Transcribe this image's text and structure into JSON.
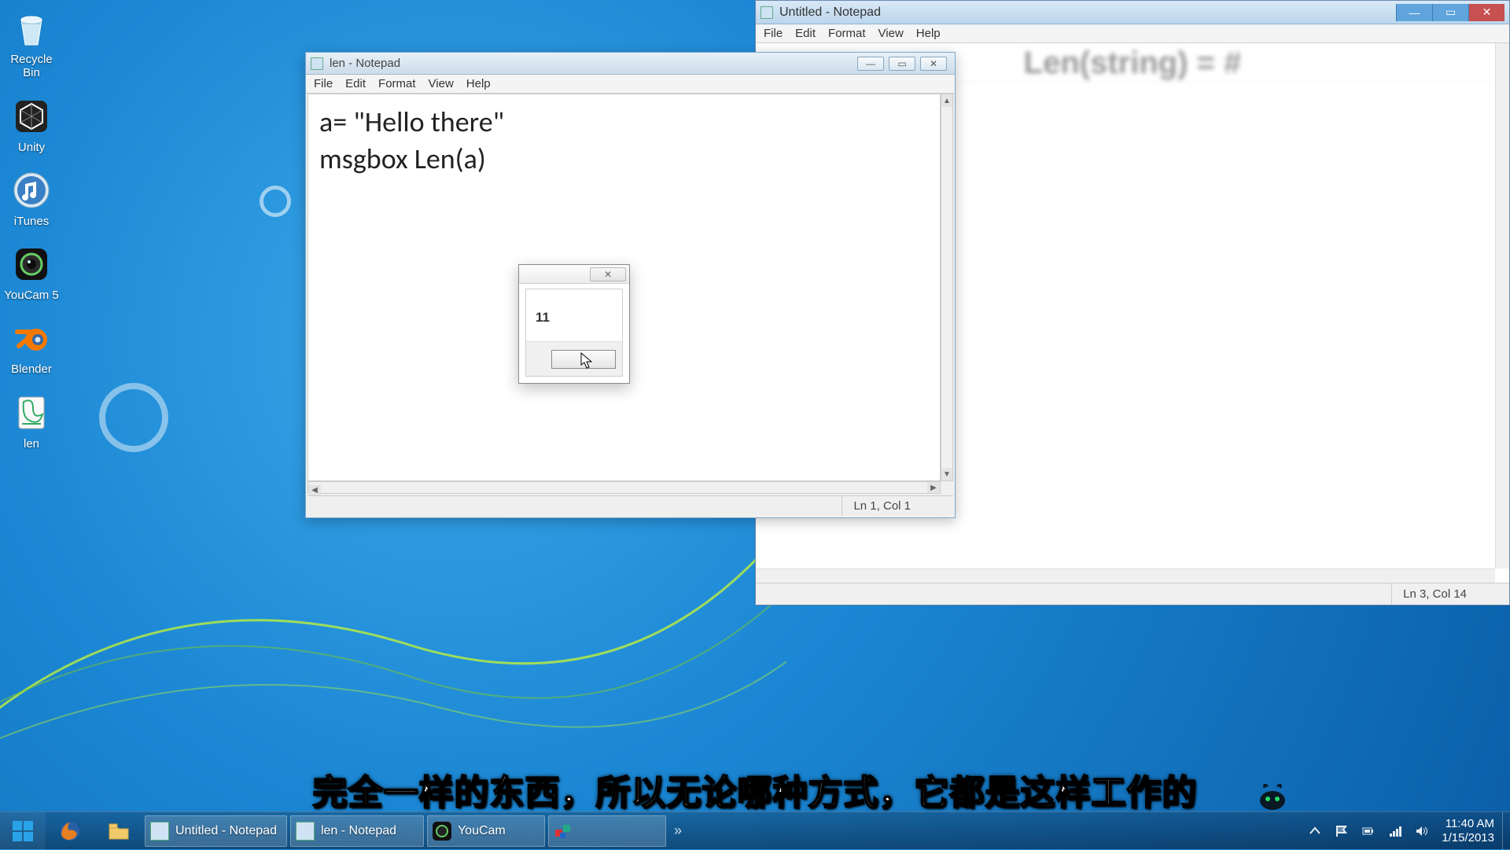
{
  "desktop": {
    "icons": [
      {
        "name": "recycle-bin",
        "label": "Recycle\nBin"
      },
      {
        "name": "unity",
        "label": "Unity"
      },
      {
        "name": "itunes",
        "label": "iTunes"
      },
      {
        "name": "youcam",
        "label": "YouCam 5"
      },
      {
        "name": "blender",
        "label": "Blender"
      },
      {
        "name": "len-script",
        "label": "len"
      }
    ]
  },
  "untitled_window": {
    "title": "Untitled - Notepad",
    "menu": [
      "File",
      "Edit",
      "Format",
      "View",
      "Help"
    ],
    "blurred_heading": "Len(string) = #",
    "status": "Ln 3, Col 14"
  },
  "len_window": {
    "title": "len - Notepad",
    "menu": [
      "File",
      "Edit",
      "Format",
      "View",
      "Help"
    ],
    "code": "a= \"Hello there\"\nmsgbox Len(a)",
    "status": "Ln 1, Col 1"
  },
  "msgbox": {
    "text": "11",
    "ok_label": ""
  },
  "subtitle": "完全一样的东西，所以无论哪种方式，它都是这样工作的",
  "taskbar": {
    "tasks": [
      {
        "name": "untitled-notepad",
        "label": "Untitled - Notepad"
      },
      {
        "name": "len-notepad",
        "label": "len - Notepad"
      },
      {
        "name": "youcam-task",
        "label": "YouCam"
      }
    ],
    "clock_time": "11:40 AM",
    "clock_date": "1/15/2013"
  }
}
